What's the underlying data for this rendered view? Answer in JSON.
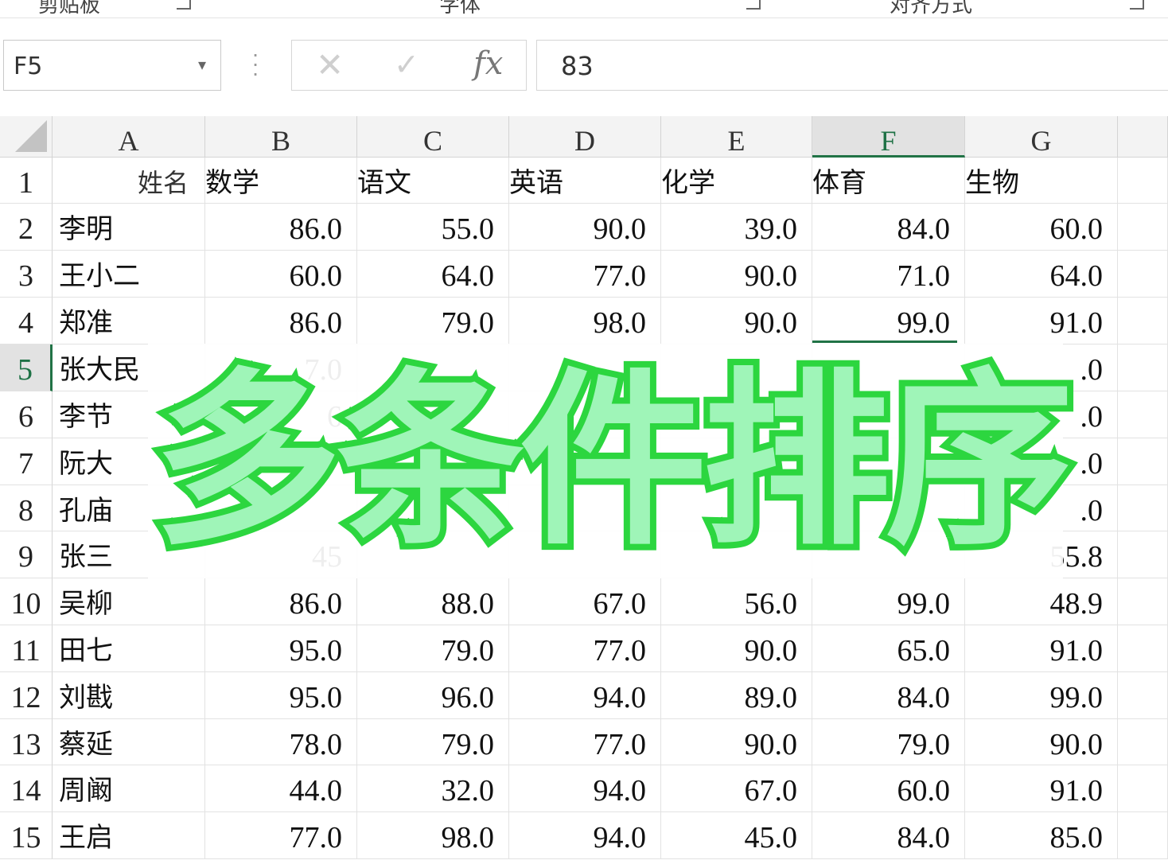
{
  "ribbon": {
    "groups": [
      "剪贴板",
      "字体",
      "对齐方式"
    ]
  },
  "formula_bar": {
    "name_box": "F5",
    "cancel_icon": "✕",
    "enter_icon": "✓",
    "fx_label": "fx",
    "content": "83"
  },
  "sheet": {
    "columns": [
      "A",
      "B",
      "C",
      "D",
      "E",
      "F",
      "G"
    ],
    "selected_column": "F",
    "selected_row": 5,
    "header_row": [
      "姓名",
      "数学",
      "语文",
      "英语",
      "化学",
      "体育",
      "生物"
    ],
    "rows": [
      {
        "n": "2",
        "name": "李明",
        "vals": [
          "86.0",
          "55.0",
          "90.0",
          "39.0",
          "84.0",
          "60.0"
        ]
      },
      {
        "n": "3",
        "name": "王小二",
        "vals": [
          "60.0",
          "64.0",
          "77.0",
          "90.0",
          "71.0",
          "64.0"
        ]
      },
      {
        "n": "4",
        "name": "郑准",
        "vals": [
          "86.0",
          "79.0",
          "98.0",
          "90.0",
          "99.0",
          "91.0"
        ]
      },
      {
        "n": "5",
        "name": "张大民",
        "vals": [
          "7.0",
          "",
          "",
          "",
          "",
          ".0"
        ]
      },
      {
        "n": "6",
        "name": "李节",
        "vals": [
          "6",
          "",
          "",
          "",
          "",
          ".0"
        ]
      },
      {
        "n": "7",
        "name": "阮大",
        "vals": [
          "",
          "",
          "",
          "",
          "",
          ".0"
        ]
      },
      {
        "n": "8",
        "name": "孔庙",
        "vals": [
          "",
          "",
          "",
          "",
          "",
          ".0"
        ]
      },
      {
        "n": "9",
        "name": "张三",
        "vals": [
          "45",
          "",
          "",
          "",
          "",
          "55.8"
        ]
      },
      {
        "n": "10",
        "name": "吴柳",
        "vals": [
          "86.0",
          "88.0",
          "67.0",
          "56.0",
          "99.0",
          "48.9"
        ]
      },
      {
        "n": "11",
        "name": "田七",
        "vals": [
          "95.0",
          "79.0",
          "77.0",
          "90.0",
          "65.0",
          "91.0"
        ]
      },
      {
        "n": "12",
        "name": "刘戡",
        "vals": [
          "95.0",
          "96.0",
          "94.0",
          "89.0",
          "84.0",
          "99.0"
        ]
      },
      {
        "n": "13",
        "name": "蔡延",
        "vals": [
          "78.0",
          "79.0",
          "77.0",
          "90.0",
          "79.0",
          "90.0"
        ]
      },
      {
        "n": "14",
        "name": "周阚",
        "vals": [
          "44.0",
          "32.0",
          "94.0",
          "67.0",
          "60.0",
          "91.0"
        ]
      },
      {
        "n": "15",
        "name": "王启",
        "vals": [
          "77.0",
          "98.0",
          "94.0",
          "45.0",
          "84.0",
          "85.0"
        ]
      }
    ]
  },
  "overlay_title": "多条件排序",
  "colors": {
    "title_fill": "#9ff5b8",
    "title_stroke": "#2cd63f",
    "select_green": "#217346"
  }
}
